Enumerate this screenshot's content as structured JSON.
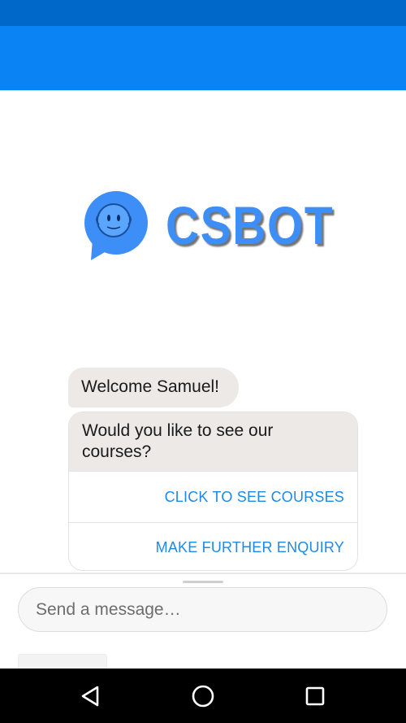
{
  "logo": {
    "text": "CSBOT",
    "bubble_color": "#3e8ef7"
  },
  "chat": {
    "welcome": "Welcome Samuel!",
    "question": "Would you like to see our courses?",
    "buttons": [
      "CLICK TO SEE COURSES",
      "MAKE FURTHER ENQUIRY"
    ]
  },
  "composer": {
    "placeholder": "Send a message…"
  },
  "icons": {
    "back": "back-triangle-icon",
    "home": "home-circle-icon",
    "recents": "recents-square-icon"
  },
  "colors": {
    "status_bar": "#0068c8",
    "app_bar": "#0a84f5",
    "accent": "#1e8ae6",
    "bubble": "#ece9e6"
  }
}
